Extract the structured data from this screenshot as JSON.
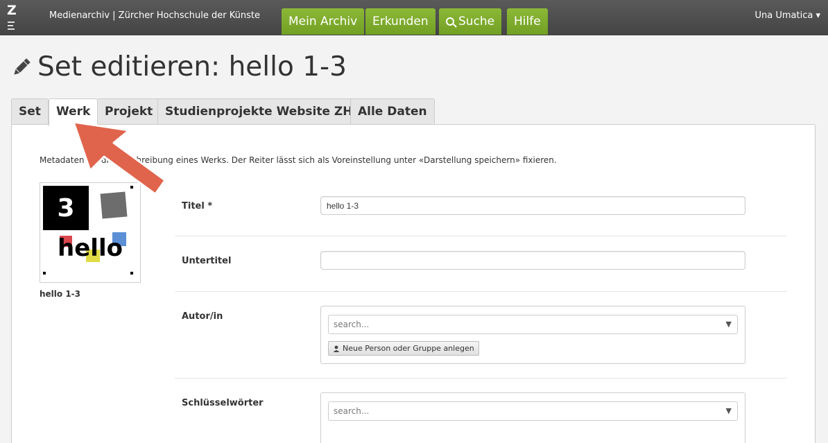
{
  "app": {
    "logo_letter": "Z",
    "brand": "Medienarchiv | Zürcher Hochschule der Künste",
    "nav": {
      "mein_archiv": "Mein Archiv",
      "erkunden": "Erkunden",
      "suche": "Suche",
      "hilfe": "Hilfe"
    },
    "user": "Una Umatica ▾"
  },
  "page": {
    "title": "Set editieren: hello 1-3",
    "tabs": [
      "Set",
      "Werk",
      "Projekt",
      "Studienprojekte Website ZHdK",
      "Alle Daten"
    ],
    "active_tab": "Werk",
    "description": "Metadaten für die Beschreibung eines Werks. Der Reiter lässt sich als Voreinstellung unter «Darstellung speichern» fixieren."
  },
  "thumbnail": {
    "number": "3",
    "word": "hello",
    "caption": "hello 1-3"
  },
  "form": {
    "titel": {
      "label": "Titel *",
      "value": "hello 1-3"
    },
    "untertitel": {
      "label": "Untertitel",
      "value": ""
    },
    "autor": {
      "label": "Autor/in",
      "placeholder": "search...",
      "new_button": "Neue Person oder Gruppe anlegen"
    },
    "schluesselwoerter": {
      "label": "Schlüsselwörter",
      "placeholder": "search..."
    }
  },
  "colors": {
    "topbar": "#4d4d4d",
    "nav_green": "#7eab2c",
    "arrow": "#e0644c"
  }
}
